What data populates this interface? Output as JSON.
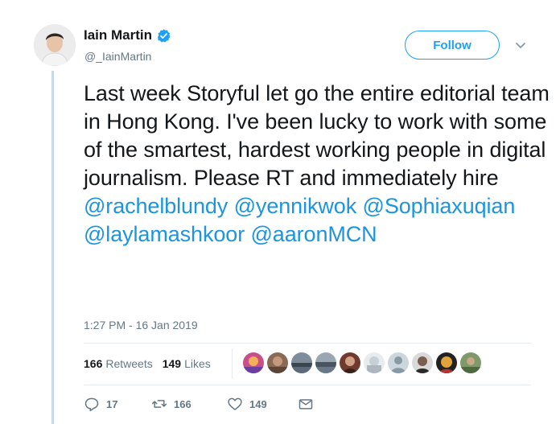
{
  "author": {
    "name": "Iain Martin",
    "handle": "@_IainMartin",
    "verified": true
  },
  "follow_label": "Follow",
  "tweet": {
    "text_parts": [
      "Last week Storyful let go the entire editorial team in Hong Kong. I've been lucky to work with some of the smartest, hardest working people in digital journalism. Please RT and immediately hire ",
      "@rachelblundy",
      " ",
      "@yennikwok",
      " ",
      "@Sophiaxuqian",
      " ",
      "@laylamashkoor",
      " ",
      "@aaronMCN"
    ],
    "timestamp": "1:27 PM - 16 Jan 2019"
  },
  "stats": {
    "retweets_count": "166",
    "retweets_label": "Retweets",
    "likes_count": "149",
    "likes_label": "Likes"
  },
  "likers": [
    "liker-1",
    "liker-2",
    "liker-3",
    "liker-4",
    "liker-5",
    "liker-6",
    "liker-7",
    "liker-8",
    "liker-9"
  ],
  "actions": {
    "reply_count": "17",
    "retweet_count": "166",
    "like_count": "149"
  },
  "colors": {
    "accent": "#1da1f2",
    "mention": "#1b95e0",
    "secondary_text": "#657786",
    "thread_line": "#c4dbe6"
  }
}
